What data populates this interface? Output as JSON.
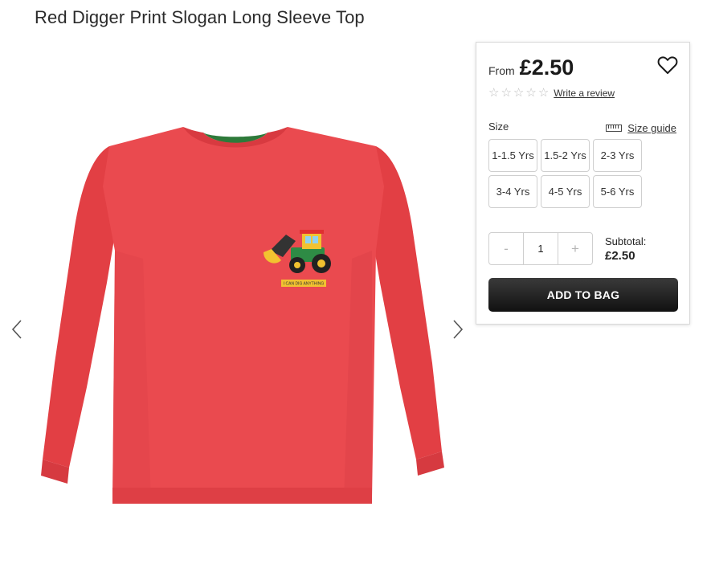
{
  "product": {
    "title": "Red Digger Print Slogan Long Sleeve Top",
    "print_slogan": "I CAN DIG ANYTHING"
  },
  "gallery": {
    "prev_icon": "chevron-left-icon",
    "next_icon": "chevron-right-icon"
  },
  "pricing": {
    "from_label": "From",
    "price": "£2.50"
  },
  "rating": {
    "stars": 0,
    "max_stars": 5,
    "write_review": "Write a review"
  },
  "size": {
    "label": "Size",
    "guide_label": "Size guide",
    "options": [
      "1-1.5 Yrs",
      "1.5-2 Yrs",
      "2-3 Yrs",
      "3-4 Yrs",
      "4-5 Yrs",
      "5-6 Yrs"
    ]
  },
  "quantity": {
    "minus": "-",
    "value": "1",
    "plus": "+"
  },
  "subtotal": {
    "label": "Subtotal:",
    "value": "£2.50"
  },
  "actions": {
    "add_to_bag": "ADD TO BAG"
  },
  "colors": {
    "shirt": "#e8474a",
    "collar_trim": "#2e7a3a",
    "button_dark": "#1a1a1a"
  }
}
